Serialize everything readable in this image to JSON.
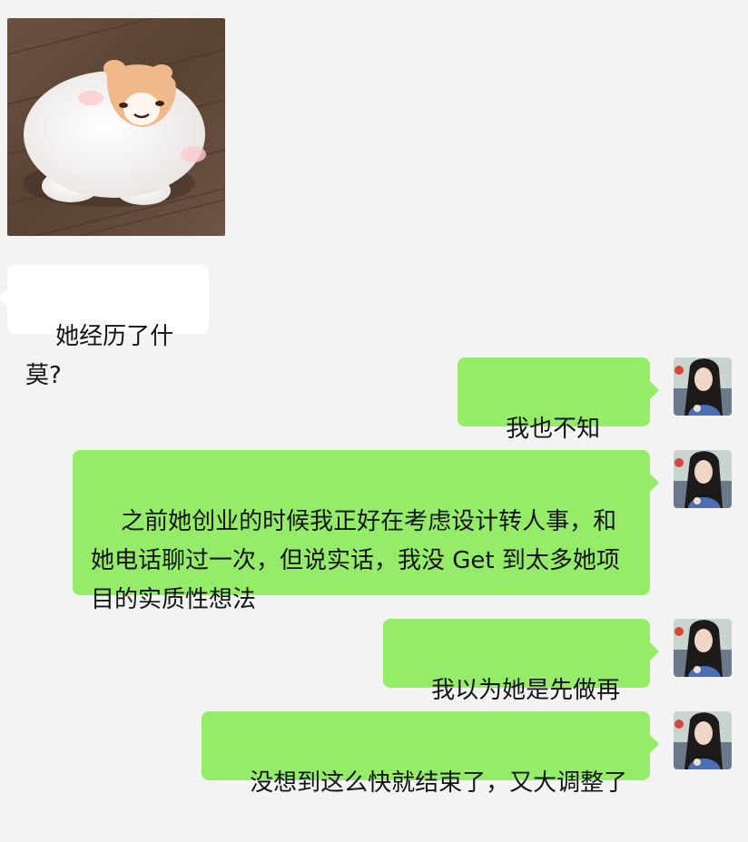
{
  "chat": {
    "sticker": {
      "icon": "hamster-sticker-icon"
    },
    "messages": [
      {
        "side": "in",
        "text": "她经历了什莫?"
      },
      {
        "side": "out",
        "text": "我也不知道。。"
      },
      {
        "side": "out",
        "text": "之前她创业的时候我正好在考虑设计转人事，和她电话聊过一次，但说实话，我没 Get 到太多她项目的实质性想法"
      },
      {
        "side": "out",
        "text": "我以为她是先做再想"
      },
      {
        "side": "out",
        "text": "没想到这么快就结束了，又大调整了"
      }
    ]
  },
  "colors": {
    "background": "#f3f3f3",
    "sent_bubble": "#95ec69",
    "received_bubble": "#ffffff"
  }
}
